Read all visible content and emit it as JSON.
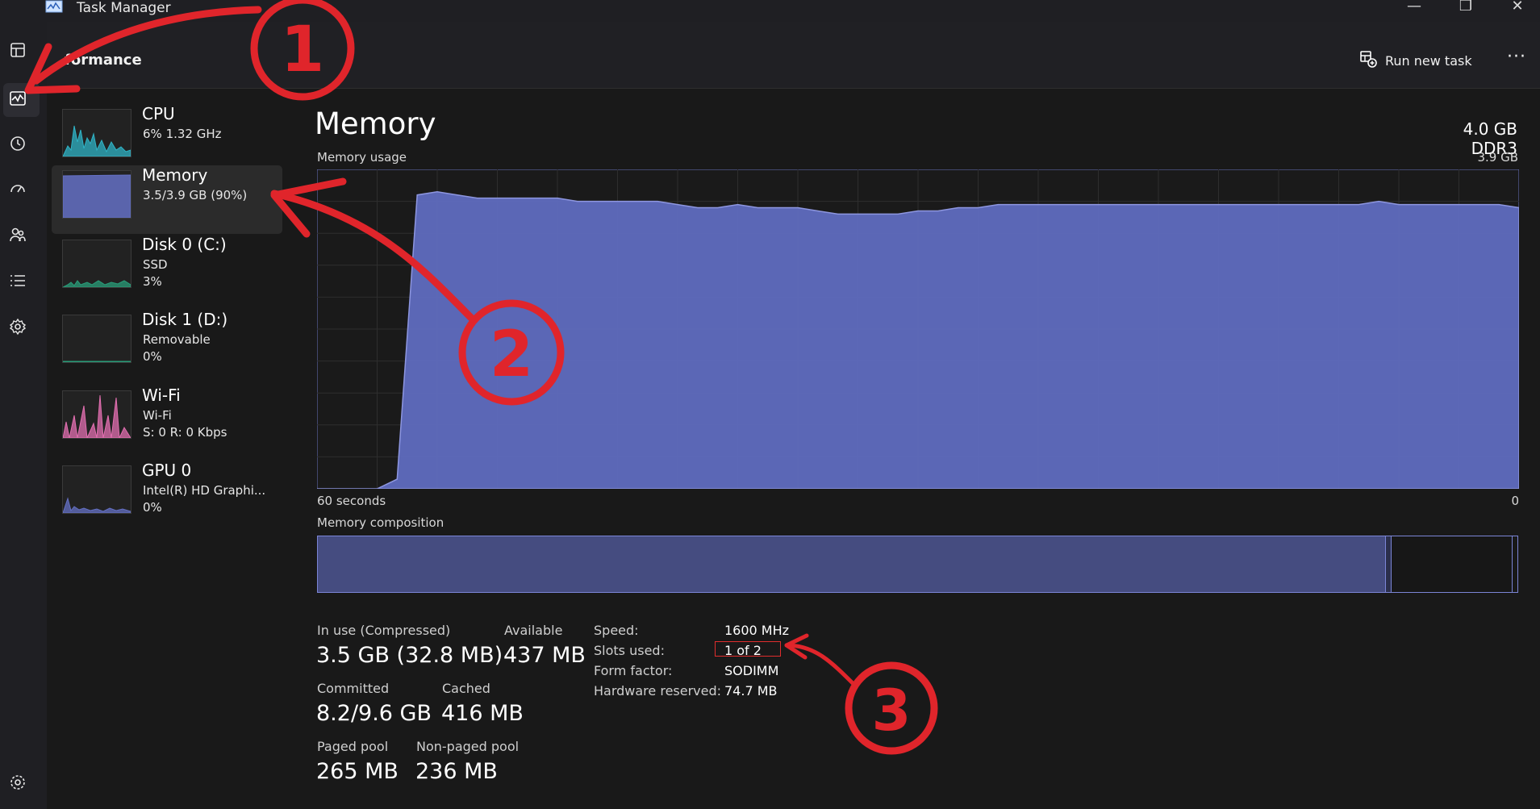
{
  "app": {
    "title": "Task Manager"
  },
  "window_controls": {
    "minimize": "—",
    "restore": "❐",
    "close": "✕"
  },
  "header": {
    "page_title": "Performance",
    "page_title_visible": "formance",
    "run_new_task": "Run new task",
    "more": "···"
  },
  "rail": {
    "items": [
      {
        "name": "processes",
        "icon": "processes-icon"
      },
      {
        "name": "performance",
        "icon": "performance-icon",
        "selected": true
      },
      {
        "name": "app-history",
        "icon": "history-icon"
      },
      {
        "name": "startup-apps",
        "icon": "startup-icon"
      },
      {
        "name": "users",
        "icon": "users-icon"
      },
      {
        "name": "details",
        "icon": "details-icon"
      },
      {
        "name": "services",
        "icon": "services-icon"
      },
      {
        "name": "settings",
        "icon": "settings-icon"
      }
    ]
  },
  "devices": [
    {
      "name": "CPU",
      "line1": "6%  1.32 GHz",
      "line2": "",
      "color": "#2fb3c6"
    },
    {
      "name": "Memory",
      "line1": "3.5/3.9 GB (90%)",
      "line2": "",
      "color": "#6470c4",
      "selected": true
    },
    {
      "name": "Disk 0 (C:)",
      "line1": "SSD",
      "line2": "3%",
      "color": "#2a9d7a"
    },
    {
      "name": "Disk 1 (D:)",
      "line1": "Removable",
      "line2": "0%",
      "color": "#2a9d7a"
    },
    {
      "name": "Wi-Fi",
      "line1": "Wi-Fi",
      "line2": "S: 0  R: 0 Kbps",
      "color": "#e26fb0"
    },
    {
      "name": "GPU 0",
      "line1": "Intel(R) HD Graphi...",
      "line2": "0%",
      "color": "#6470c4"
    }
  ],
  "memory": {
    "title": "Memory",
    "type": "4.0 GB DDR3",
    "usage_label": "Memory usage",
    "max_label": "3.9 GB",
    "time_left": "60 seconds",
    "time_right": "0",
    "composition_label": "Memory composition",
    "usage_fraction": [
      0,
      0,
      0,
      0,
      0.03,
      0.92,
      0.93,
      0.92,
      0.91,
      0.91,
      0.91,
      0.91,
      0.91,
      0.9,
      0.9,
      0.9,
      0.9,
      0.9,
      0.89,
      0.88,
      0.88,
      0.89,
      0.88,
      0.88,
      0.88,
      0.87,
      0.86,
      0.86,
      0.86,
      0.86,
      0.87,
      0.87,
      0.88,
      0.88,
      0.89,
      0.89,
      0.89,
      0.89,
      0.89,
      0.89,
      0.89,
      0.89,
      0.89,
      0.89,
      0.89,
      0.89,
      0.89,
      0.89,
      0.89,
      0.89,
      0.89,
      0.89,
      0.89,
      0.9,
      0.89,
      0.89,
      0.89,
      0.89,
      0.89,
      0.89,
      0.88
    ],
    "composition": {
      "in_use_fraction": 0.89,
      "modified_fraction": 0.005,
      "standby_fraction": 0.1,
      "free_fraction": 0.005
    },
    "stats": {
      "in_use_label": "In use (Compressed)",
      "in_use_value": "3.5 GB (32.8 MB)",
      "available_label": "Available",
      "available_value": "437 MB",
      "committed_label": "Committed",
      "committed_value": "8.2/9.6 GB",
      "cached_label": "Cached",
      "cached_value": "416 MB",
      "paged_label": "Paged pool",
      "paged_value": "265 MB",
      "nonpaged_label": "Non-paged pool",
      "nonpaged_value": "236 MB"
    },
    "specs": {
      "speed_label": "Speed:",
      "speed_value": "1600 MHz",
      "slots_label": "Slots used:",
      "slots_value": "1 of 2",
      "form_label": "Form factor:",
      "form_value": "SODIMM",
      "hw_label": "Hardware reserved:",
      "hw_value": "74.7 MB"
    }
  },
  "annotations": {
    "color": "#e0252b",
    "callouts": [
      {
        "number": "1"
      },
      {
        "number": "2"
      },
      {
        "number": "3"
      }
    ]
  }
}
